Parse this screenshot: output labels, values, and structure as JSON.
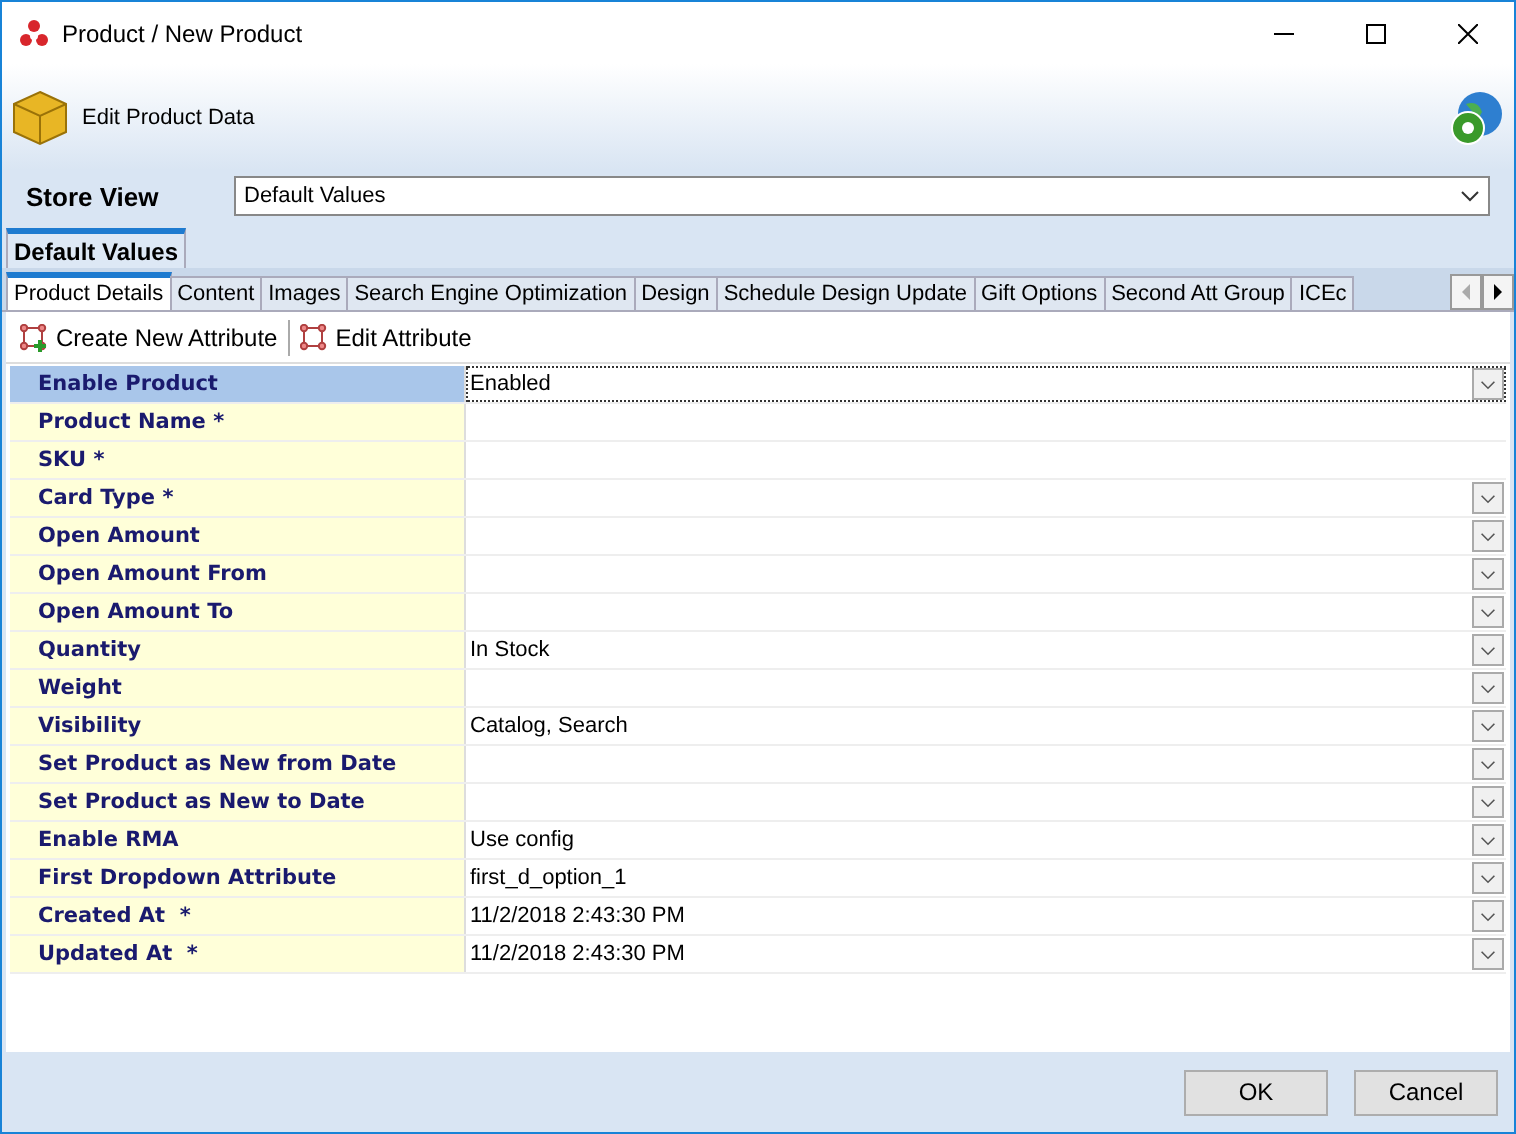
{
  "window": {
    "title": "Product / New Product"
  },
  "header": {
    "title": "Edit Product Data"
  },
  "store_view": {
    "label": "Store View",
    "value": "Default Values"
  },
  "store_tabs": [
    {
      "label": "Default Values",
      "selected": true
    }
  ],
  "tabs": [
    {
      "label": "Product Details",
      "selected": true
    },
    {
      "label": "Content",
      "selected": false
    },
    {
      "label": "Images",
      "selected": false
    },
    {
      "label": "Search Engine Optimization",
      "selected": false
    },
    {
      "label": "Design",
      "selected": false
    },
    {
      "label": "Schedule Design Update",
      "selected": false
    },
    {
      "label": "Gift Options",
      "selected": false
    },
    {
      "label": "Second Att Group",
      "selected": false
    },
    {
      "label": "ICEc",
      "selected": false
    }
  ],
  "toolbar": [
    "Create New Attribute",
    "Edit Attribute"
  ],
  "rows": [
    {
      "label": "Enable Product",
      "value": "Enabled",
      "kind": "dropdown",
      "selected": true
    },
    {
      "label": "Product Name *",
      "kind": "text",
      "selected": false
    },
    {
      "label": "SKU *",
      "kind": "text",
      "selected": false
    },
    {
      "label": "Card Type *",
      "kind": "dropdown",
      "selected": false
    },
    {
      "label": "Open Amount",
      "kind": "dropdown",
      "selected": false
    },
    {
      "label": "Open Amount From",
      "kind": "dropdown",
      "selected": false
    },
    {
      "label": "Open Amount To",
      "kind": "dropdown",
      "selected": false
    },
    {
      "label": "Quantity",
      "value": "In Stock",
      "kind": "dropdown",
      "selected": false
    },
    {
      "label": "Weight",
      "kind": "dropdown",
      "selected": false
    },
    {
      "label": "Visibility",
      "value": "Catalog, Search",
      "kind": "dropdown",
      "selected": false
    },
    {
      "label": "Set Product as New from Date",
      "kind": "dropdown",
      "selected": false
    },
    {
      "label": "Set Product as New to Date",
      "kind": "dropdown",
      "selected": false
    },
    {
      "label": "Enable RMA",
      "value": "Use config",
      "kind": "dropdown",
      "selected": false
    },
    {
      "label": "First Dropdown Attribute",
      "value": "first_d_option_1",
      "kind": "dropdown",
      "selected": false
    },
    {
      "label": "Created At  *",
      "value": "11/2/2018 2:43:30 PM",
      "kind": "dropdown",
      "selected": false
    },
    {
      "label": "Updated At  *",
      "value": "11/2/2018 2:43:30 PM",
      "kind": "dropdown",
      "selected": false
    }
  ],
  "buttons": [
    "OK",
    "Cancel"
  ]
}
